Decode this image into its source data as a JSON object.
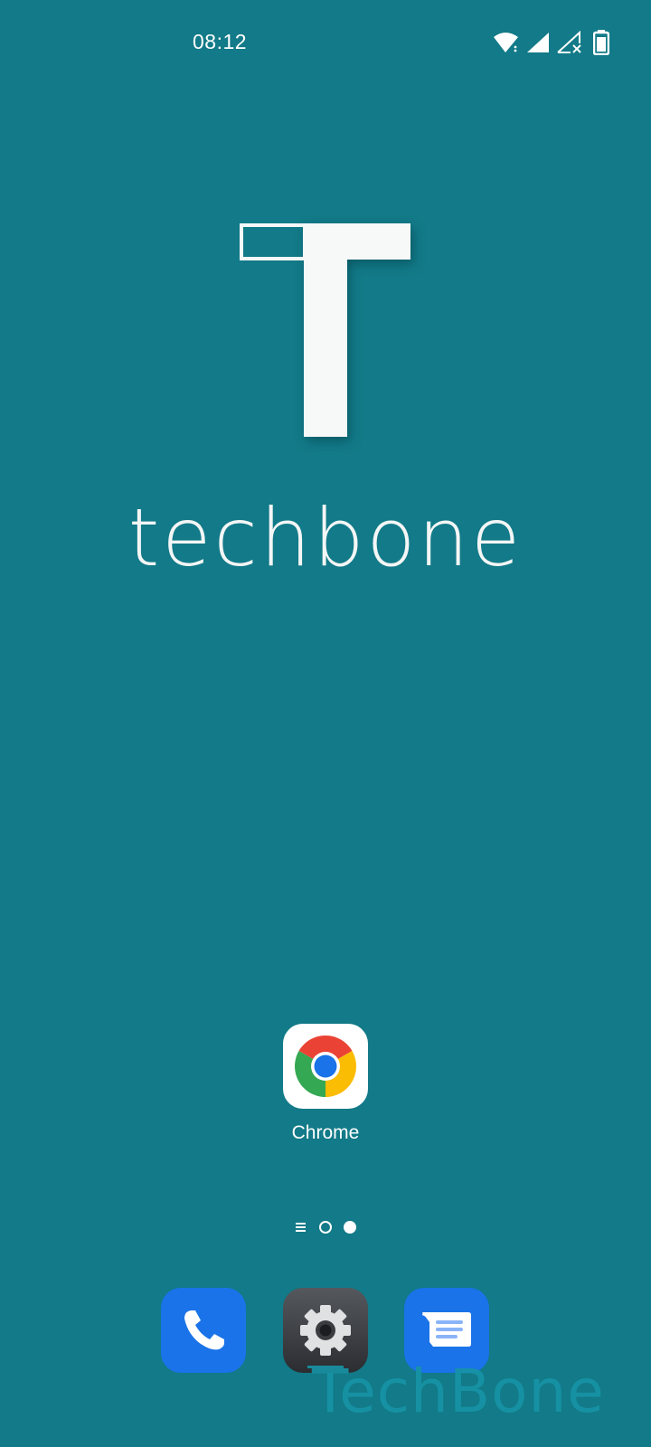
{
  "status_bar": {
    "time": "08:12",
    "icons": [
      "wifi-icon",
      "cell-signal-icon",
      "cell-signal-no-sim-icon",
      "battery-icon"
    ]
  },
  "wallpaper": {
    "logo_letter": "T",
    "word": "techbone",
    "background_color": "#127a88"
  },
  "home_apps": [
    {
      "label": "Chrome",
      "icon": "chrome-icon"
    }
  ],
  "page_indicator": {
    "pages": 2,
    "current_page": 2,
    "has_feed_menu": true
  },
  "dock": [
    {
      "app": "Phone",
      "icon": "phone-icon",
      "color": "#1a73e8"
    },
    {
      "app": "Settings",
      "icon": "gear-icon",
      "color": "#3b3d42"
    },
    {
      "app": "Messages",
      "icon": "message-icon",
      "color": "#1a73e8"
    }
  ],
  "watermark": "TechBone"
}
